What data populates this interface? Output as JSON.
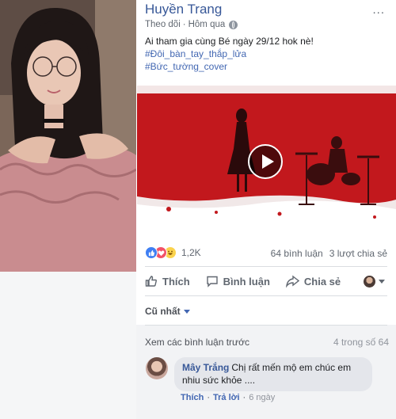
{
  "post": {
    "author": "Huyền Trang",
    "follow": "Theo dõi",
    "separator": "·",
    "time": "Hôm qua",
    "more": "...",
    "text": "Ai tham gia cùng Bé ngày 29/12 hok nè!",
    "hashtags": [
      "#Đôi_bàn_tay_thắp_lửa",
      "#Bức_tường_cover"
    ]
  },
  "reactions": {
    "icons": [
      "like-reaction-icon",
      "love-reaction-icon",
      "haha-reaction-icon"
    ],
    "count": "1,2K",
    "comments": "64 bình luận",
    "shares": "3 lượt chia sẻ"
  },
  "actions": {
    "like": "Thích",
    "comment": "Bình luận",
    "share": "Chia sẻ"
  },
  "comments": {
    "sort_label": "Cũ nhất",
    "previous": "Xem các bình luận trước",
    "pagination": "4 trong số 64",
    "items": [
      {
        "name": "Mây Trắng",
        "text": "Chị rất mến mộ em chúc em nhiu sức khỏe ....",
        "like": "Thích",
        "reply": "Trả lời",
        "time": "6 ngày"
      }
    ]
  },
  "colors": {
    "link": "#385898",
    "accent": "#4267b2",
    "video_red": "#c41a1f"
  }
}
